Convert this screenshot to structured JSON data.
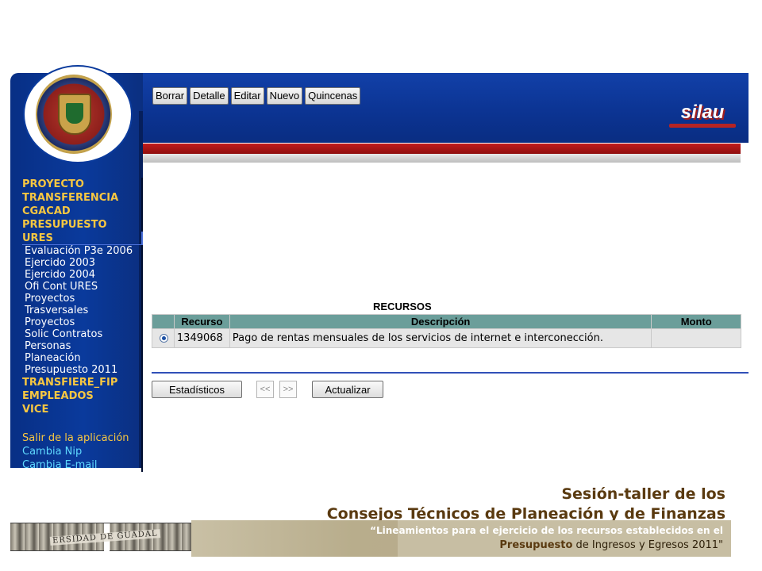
{
  "toolbar": {
    "buttons": [
      "Borrar",
      "Detalle",
      "Editar",
      "Nuevo",
      "Quincenas"
    ]
  },
  "brand": {
    "name": "silau"
  },
  "logo": {
    "text": "UNIVERSIDAD DE GUADALAJARA"
  },
  "sidebar": {
    "top_items": [
      "PROYECTO",
      "TRANSFERENCIA",
      "CGACAD",
      "PRESUPUESTO",
      "URES"
    ],
    "sub_items": [
      "Evaluación P3e 2006",
      "Ejercido 2003",
      "Ejercido 2004",
      "Ofi Cont URES",
      "Proyectos",
      "Trasversales",
      "Proyectos",
      "Solic Contratos",
      "Personas",
      "Planeación",
      "Presupuesto 2011"
    ],
    "bottom_items": [
      "TRANSFIERE_FIP",
      "EMPLEADOS",
      "VICE"
    ],
    "exit": "Salir de la aplicación",
    "links": [
      "Cambia Nip",
      "Cambia E-mail"
    ]
  },
  "table": {
    "title": "RECURSOS",
    "headers": [
      "Recurso",
      "Descripción",
      "Monto"
    ],
    "rows": [
      {
        "recurso": "1349068",
        "descripcion": "Pago de rentas mensuales de los servicios de internet e interconección.",
        "monto": "",
        "selected": true
      }
    ]
  },
  "actions": {
    "stats": "Estadísticos",
    "prev": "<<",
    "next": ">>",
    "update": "Actualizar"
  },
  "footer": {
    "title_line1": "Sesión-taller de los",
    "title_line2": "Consejos Técnicos de Planeación y de Finanzas",
    "quote_line1": "“Lineamientos para el ejercicio de los recursos establecidos en el",
    "quote_bold": "Presupuesto",
    "quote_line2_rest": " de Ingresos y Egresos 2011\"",
    "photo_text": "ERSIDAD DE GUADAL"
  },
  "colors": {
    "sidebar_blue": "#0a3a9c",
    "menu_gold": "#f7c741",
    "header_red": "#c21c1c",
    "table_header": "#6b9e9a",
    "footer_brown": "#5a3a10"
  }
}
